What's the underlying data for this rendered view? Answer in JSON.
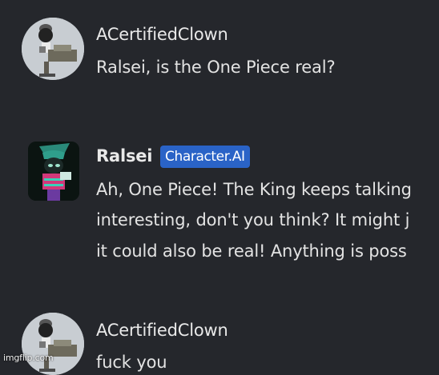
{
  "messages": [
    {
      "author": "ACertifiedClown",
      "avatar_icon": "clown-avatar-icon",
      "lines": [
        "Ralsei, is the One Piece real?"
      ]
    },
    {
      "author": "Ralsei",
      "badge": "Character.AI",
      "avatar_icon": "ralsei-avatar-icon",
      "lines": [
        "Ah, One Piece! The King keeps talking",
        "interesting, don't you think? It might j",
        "it could also be real! Anything is poss"
      ]
    },
    {
      "author": "ACertifiedClown",
      "avatar_icon": "clown-avatar-icon",
      "lines": [
        "fuck you"
      ]
    }
  ],
  "watermark": "imgflip.com",
  "colors": {
    "background": "#25272c",
    "badge": "#2a63c7",
    "text": "#e3e3e3"
  }
}
